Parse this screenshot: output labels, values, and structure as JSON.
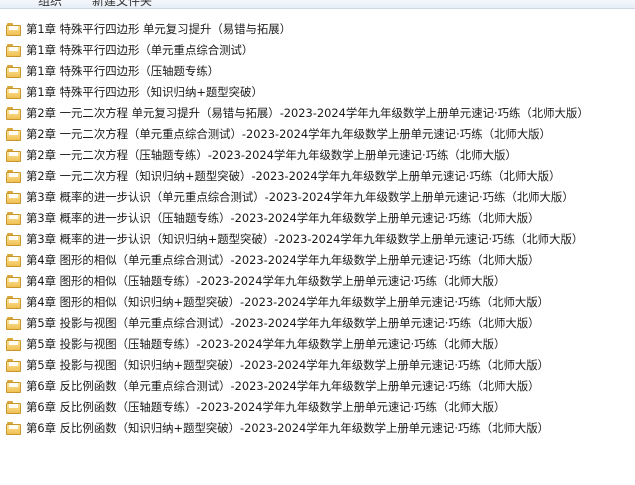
{
  "toolbar": {
    "item1": "组织",
    "item2": "新建文件夹"
  },
  "files": [
    "第1章 特殊平行四边形 单元复习提升（易错与拓展）",
    "第1章 特殊平行四边形（单元重点综合测试）",
    "第1章 特殊平行四边形（压轴题专练）",
    "第1章 特殊平行四边形（知识归纳+题型突破）",
    "第2章 一元二次方程 单元复习提升（易错与拓展）-2023-2024学年九年级数学上册单元速记·巧练（北师大版）",
    "第2章 一元二次方程（单元重点综合测试）-2023-2024学年九年级数学上册单元速记·巧练（北师大版）",
    "第2章 一元二次方程（压轴题专练）-2023-2024学年九年级数学上册单元速记·巧练（北师大版）",
    "第2章 一元二次方程（知识归纳+题型突破）-2023-2024学年九年级数学上册单元速记·巧练（北师大版）",
    "第3章 概率的进一步认识（单元重点综合测试）-2023-2024学年九年级数学上册单元速记·巧练（北师大版）",
    "第3章 概率的进一步认识（压轴题专练）-2023-2024学年九年级数学上册单元速记·巧练（北师大版）",
    "第3章 概率的进一步认识（知识归纳+题型突破）-2023-2024学年九年级数学上册单元速记·巧练（北师大版）",
    "第4章 图形的相似（单元重点综合测试）-2023-2024学年九年级数学上册单元速记·巧练（北师大版）",
    "第4章 图形的相似（压轴题专练）-2023-2024学年九年级数学上册单元速记·巧练（北师大版）",
    "第4章 图形的相似（知识归纳+题型突破）-2023-2024学年九年级数学上册单元速记·巧练（北师大版）",
    "第5章 投影与视图（单元重点综合测试）-2023-2024学年九年级数学上册单元速记·巧练（北师大版）",
    "第5章 投影与视图（压轴题专练）-2023-2024学年九年级数学上册单元速记·巧练（北师大版）",
    "第5章 投影与视图（知识归纳+题型突破）-2023-2024学年九年级数学上册单元速记·巧练（北师大版）",
    "第6章 反比例函数（单元重点综合测试）-2023-2024学年九年级数学上册单元速记·巧练（北师大版）",
    "第6章 反比例函数（压轴题专练）-2023-2024学年九年级数学上册单元速记·巧练（北师大版）",
    "第6章 反比例函数（知识归纳+题型突破）-2023-2024学年九年级数学上册单元速记·巧练（北师大版）"
  ]
}
